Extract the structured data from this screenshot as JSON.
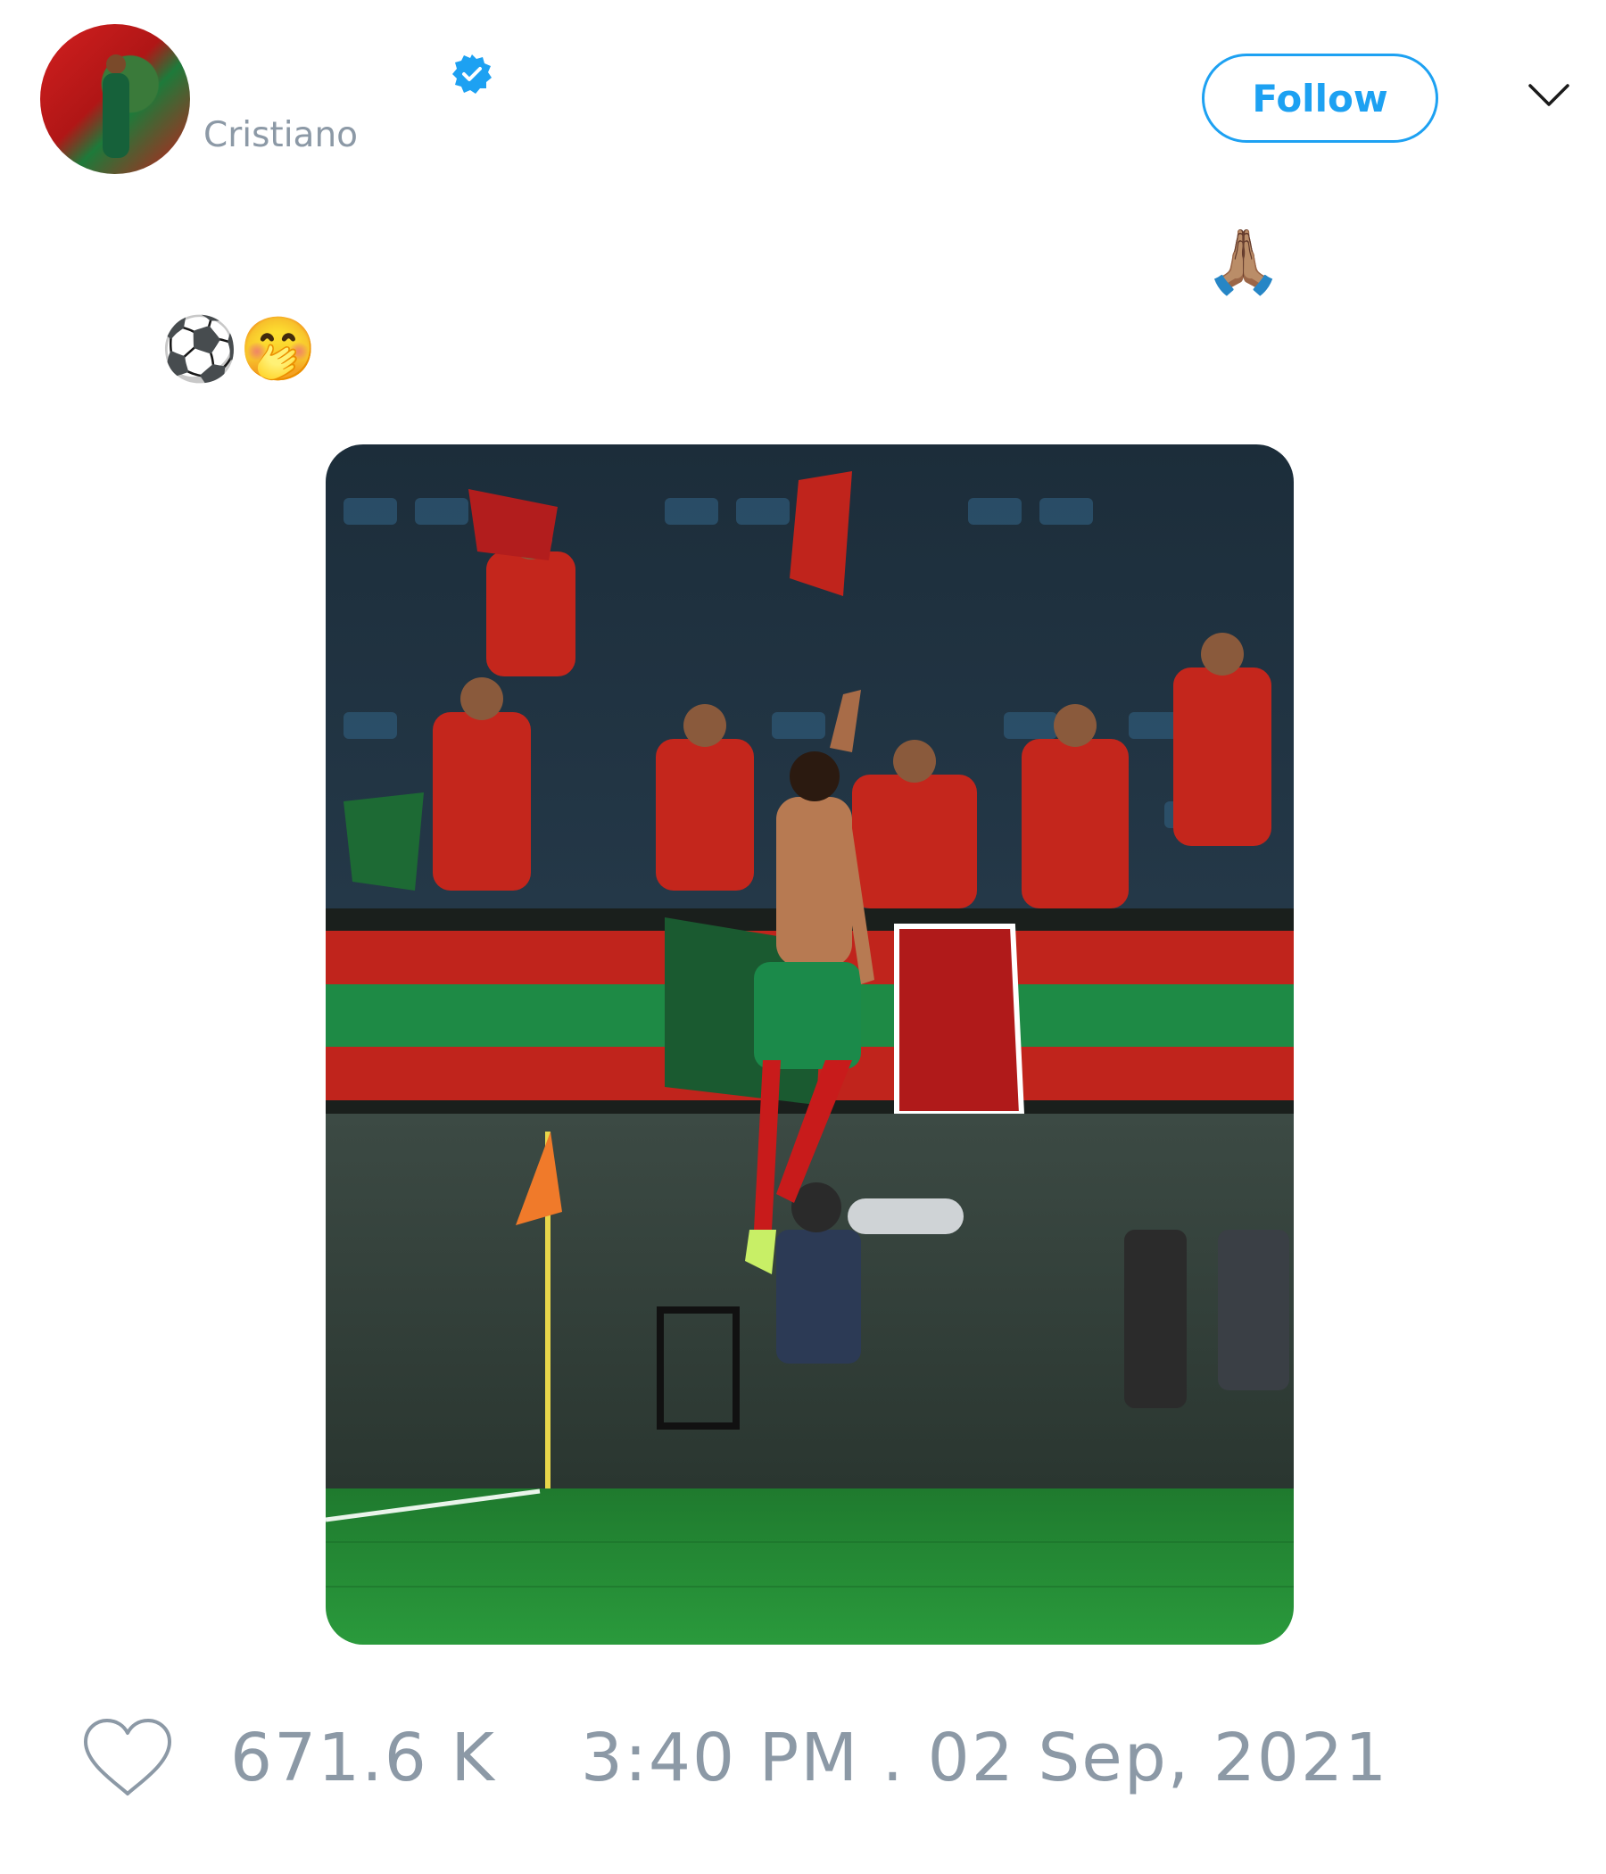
{
  "tweet": {
    "user": {
      "handle": "Cristiano",
      "verified": true,
      "avatar_icon": "profile-avatar"
    },
    "follow_label": "Follow",
    "menu_icon": "chevron-down-icon",
    "emojis": {
      "praying_hands": "🙏🏽",
      "soccer_ball": "⚽",
      "hand_over_mouth": "🤭"
    },
    "media_icon": "photo",
    "likes": "671.6 K",
    "timestamp": "3:40 PM . 02 Sep, 2021"
  },
  "colors": {
    "accent": "#1da1f2",
    "muted_text": "#8c99a6"
  }
}
